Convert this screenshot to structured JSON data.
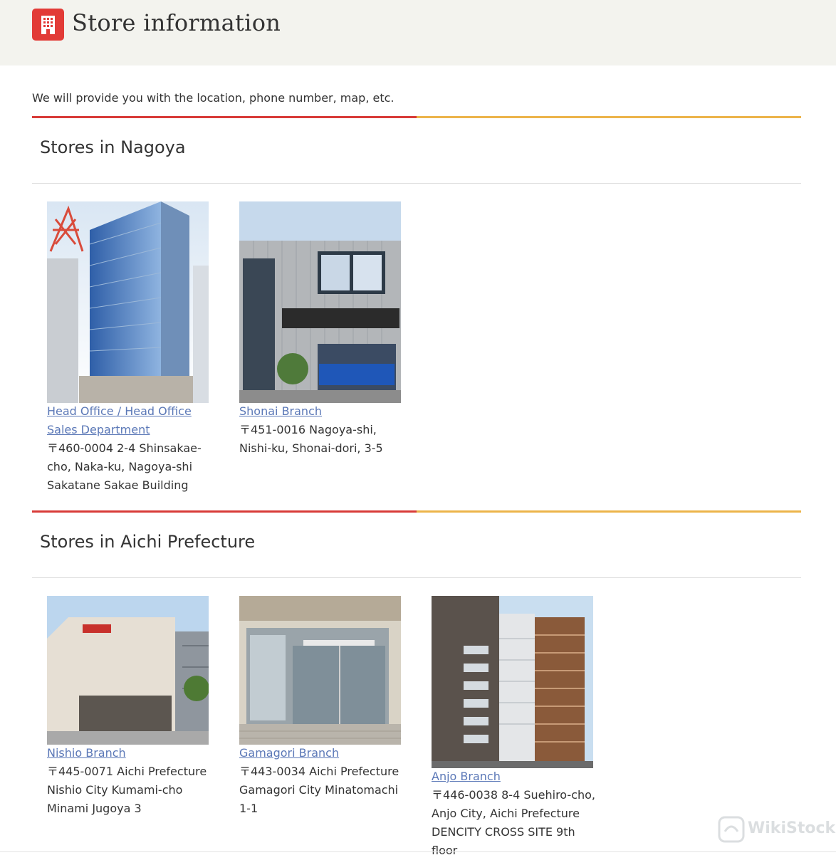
{
  "header": {
    "title": "Store information",
    "icon": "building-icon",
    "icon_color": "#e23b37"
  },
  "intro": "We will provide you with the location, phone number, map, etc.",
  "colors": {
    "rule_red": "#d83b38",
    "rule_orange": "#ecb44a",
    "link": "#5b78b7"
  },
  "sections": [
    {
      "title": "Stores in Nagoya",
      "stores": [
        {
          "name": "Head Office / Head Office Sales Department",
          "address": "〒460-0004 2-4 Shinsakae-cho, Naka-ku, Nagoya-shi Sakatane Sakae Building",
          "photo": "office-tower-photo"
        },
        {
          "name": "Shonai Branch",
          "address": "〒451-0016 Nagoya-shi, Nishi-ku, Shonai-dori, 3-5",
          "photo": "storefront-photo"
        }
      ]
    },
    {
      "title": "Stores in Aichi Prefecture",
      "stores": [
        {
          "name": "Nishio Branch",
          "address": "〒445-0071 Aichi Prefecture Nishio City Kumami-cho Minami Jugoya 3",
          "photo": "branch-building-photo"
        },
        {
          "name": "Gamagori Branch",
          "address": "〒443-0034 Aichi Prefecture Gamagori City Minatomachi 1-1",
          "photo": "glass-entrance-photo"
        },
        {
          "name": "Anjo Branch",
          "address": "〒446-0038 8-4 Suehiro-cho, Anjo City, Aichi Prefecture DENCITY CROSS SITE 9th floor",
          "photo": "high-rise-photo"
        }
      ]
    }
  ],
  "watermark": "WikiStock"
}
